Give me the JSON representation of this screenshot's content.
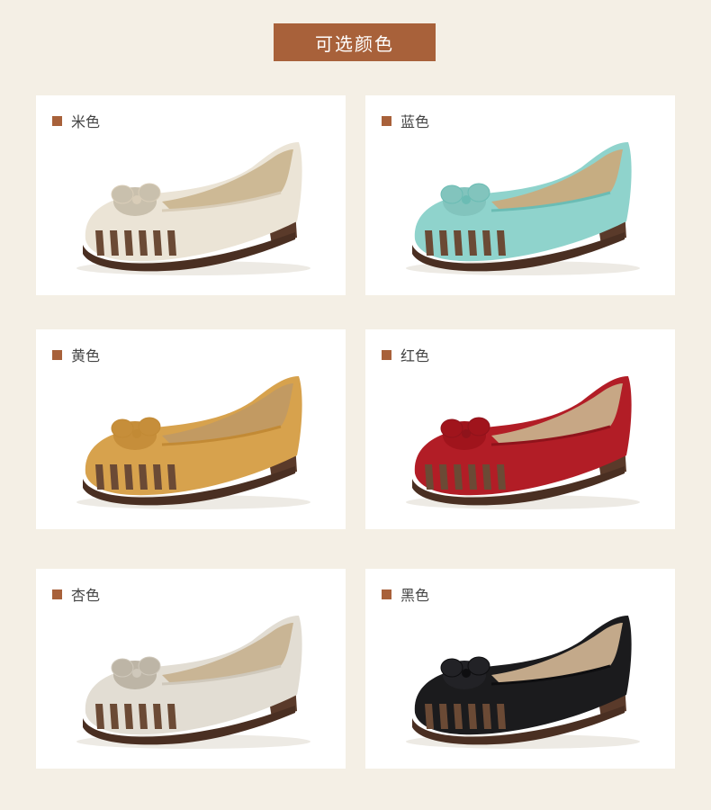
{
  "header": {
    "title": "可选颜色"
  },
  "colors": [
    {
      "label": "米色",
      "upper": "#ebe4d6",
      "trim": "#d9cdb8",
      "lining": "#cdb995",
      "bow": "#c9c0ad"
    },
    {
      "label": "蓝色",
      "upper": "#8fd3cc",
      "trim": "#6bbcb4",
      "lining": "#c6ad82",
      "bow": "#82c4bd"
    },
    {
      "label": "黄色",
      "upper": "#d7a24d",
      "trim": "#c28a35",
      "lining": "#c29a62",
      "bow": "#c68e3a"
    },
    {
      "label": "红色",
      "upper": "#b21d26",
      "trim": "#8f131b",
      "lining": "#c7a785",
      "bow": "#a0141c"
    },
    {
      "label": "杏色",
      "upper": "#e2ddd3",
      "trim": "#cfc8bb",
      "lining": "#c9b595",
      "bow": "#bdb5a6"
    },
    {
      "label": "黑色",
      "upper": "#1b1b1d",
      "trim": "#0e0e10",
      "lining": "#c3a98a",
      "bow": "#222226"
    }
  ]
}
